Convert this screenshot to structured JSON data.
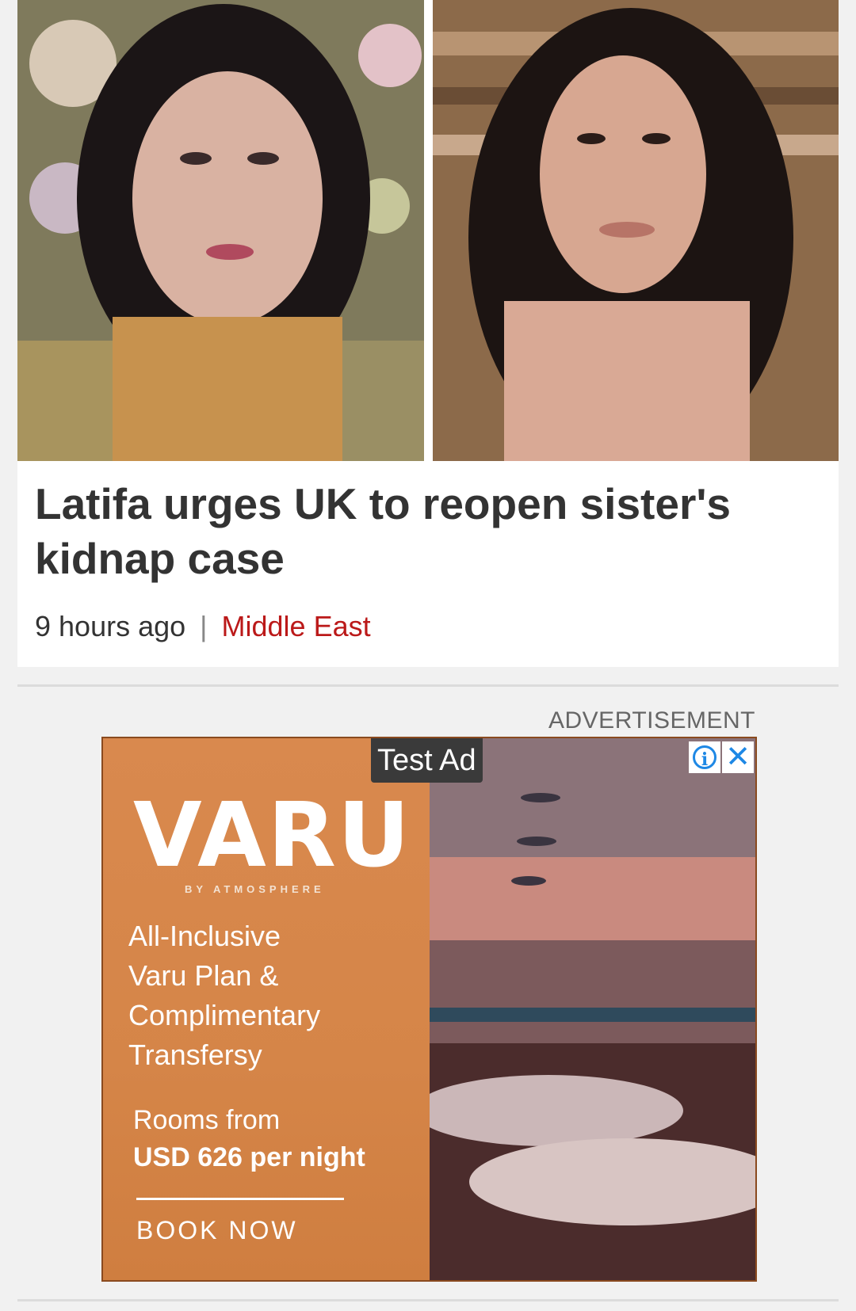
{
  "article": {
    "headline": "Latifa urges UK to reopen sister's kidnap case",
    "time": "9 hours ago",
    "separator": "|",
    "section": "Middle East",
    "section_color": "#bb1919",
    "images": [
      "photo-young-girl",
      "photo-woman-portrait"
    ]
  },
  "advertisement": {
    "label": "ADVERTISEMENT",
    "badge": "Test Ad",
    "info_icon": "info-icon",
    "close_icon": "close-icon",
    "brand": "VARU",
    "brand_sub": "BY ATMOSPHERE",
    "copy_lines": [
      "All-Inclusive",
      "Varu Plan &",
      "Complimentary",
      "Transfersy"
    ],
    "price_label": "Rooms from",
    "price": "USD 626 per night",
    "cta": "BOOK NOW",
    "accent": "#d98b4e"
  }
}
